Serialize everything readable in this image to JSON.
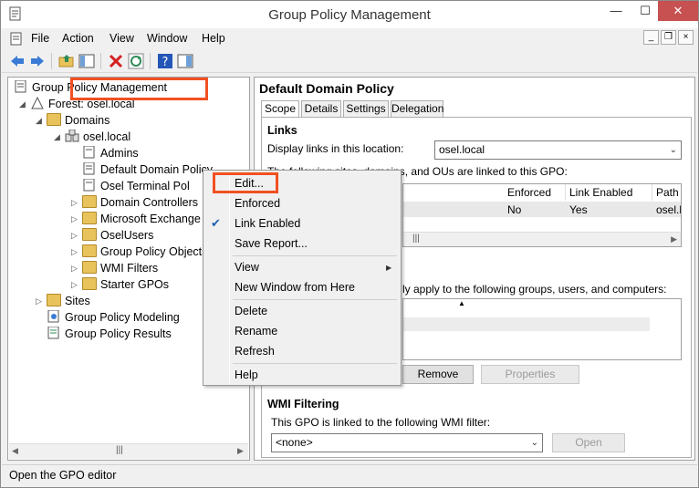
{
  "window": {
    "title": "Group Policy Management"
  },
  "menu": {
    "items": [
      "File",
      "Action",
      "View",
      "Window",
      "Help"
    ]
  },
  "tree": {
    "root": "Group Policy Management",
    "forest": "Forest: osel.local",
    "domains": "Domains",
    "domain": "osel.local",
    "children": [
      "Admins",
      "Default Domain Policy",
      "Osel Terminal Pol",
      "Domain Controllers",
      "Microsoft Exchange S",
      "OselUsers",
      "Group Policy Objects",
      "WMI Filters",
      "Starter GPOs"
    ],
    "sites": "Sites",
    "modeling": "Group Policy Modeling",
    "results": "Group Policy Results"
  },
  "right": {
    "title": "Default Domain Policy",
    "tabs": [
      "Scope",
      "Details",
      "Settings",
      "Delegation"
    ],
    "links_heading": "Links",
    "display_links_label": "Display links in this location:",
    "location_value": "osel.local",
    "linked_text": "The following sites, domains, and OUs are linked to this GPO:",
    "columns": [
      "Enforced",
      "Link Enabled",
      "Path"
    ],
    "row": [
      "No",
      "Yes",
      "osel.lo"
    ],
    "filter_text": "ly apply to the following groups, users, and computers:",
    "remove_label": "Remove",
    "properties_label": "Properties",
    "wmi_heading": "WMI Filtering",
    "wmi_text": "This GPO is linked to the following WMI filter:",
    "wmi_value": "<none>",
    "open_label": "Open"
  },
  "context_menu": {
    "edit": "Edit...",
    "enforced": "Enforced",
    "link_enabled": "Link Enabled",
    "save_report": "Save Report...",
    "view": "View",
    "new_window": "New Window from Here",
    "delete": "Delete",
    "rename": "Rename",
    "refresh": "Refresh",
    "help": "Help"
  },
  "status": {
    "text": "Open the GPO editor"
  },
  "colors": {
    "highlight": "#f25022",
    "check": "#2060b0"
  }
}
